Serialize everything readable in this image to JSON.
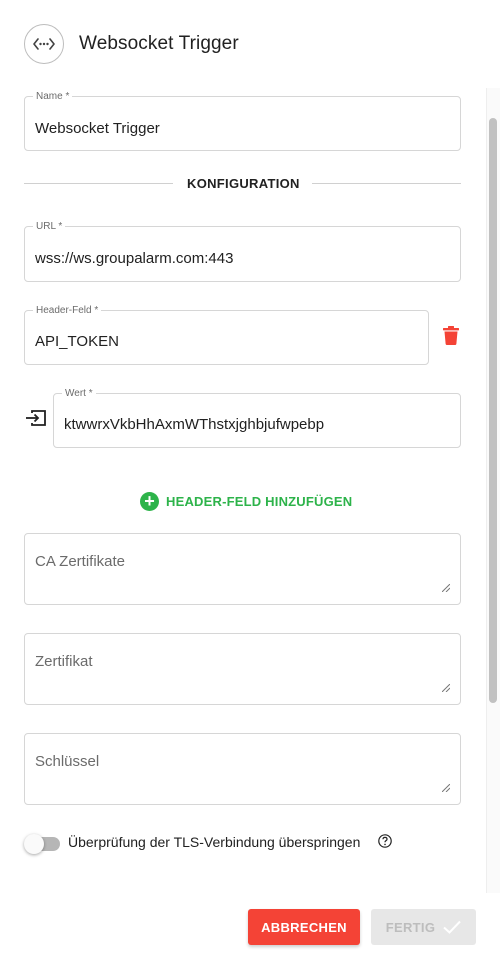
{
  "header": {
    "title": "Websocket Trigger",
    "icon": "websocket-icon"
  },
  "form": {
    "name": {
      "label": "Name *",
      "value": "Websocket Trigger"
    },
    "section_title": "KONFIGURATION",
    "url": {
      "label": "URL *",
      "value": "wss://ws.groupalarm.com:443"
    },
    "header_field": {
      "label": "Header-Feld *",
      "value": "API_TOKEN",
      "delete_icon": "trash-icon"
    },
    "header_value": {
      "label": "Wert *",
      "value": "ktwwrxVkbHhAxmWThstxjghbjufwpebp",
      "icon": "input-arrow-icon"
    },
    "add_header": {
      "label": "HEADER-FELD HINZUFÜGEN",
      "icon": "plus-circle-icon"
    },
    "ca_certificates": {
      "placeholder": "CA Zertifikate"
    },
    "certificate": {
      "placeholder": "Zertifikat"
    },
    "key": {
      "placeholder": "Schlüssel"
    },
    "skip_tls": {
      "label": "Überprüfung der TLS-Verbindung überspringen",
      "enabled": false,
      "help_icon": "help-circle-icon"
    }
  },
  "footer": {
    "cancel_label": "ABBRECHEN",
    "done_label": "FERTIG",
    "done_icon": "checkmark-icon"
  },
  "colors": {
    "danger": "#f44336",
    "success": "#2db34a",
    "disabled_bg": "#e7e7e7",
    "disabled_text": "#bdbdbd"
  }
}
